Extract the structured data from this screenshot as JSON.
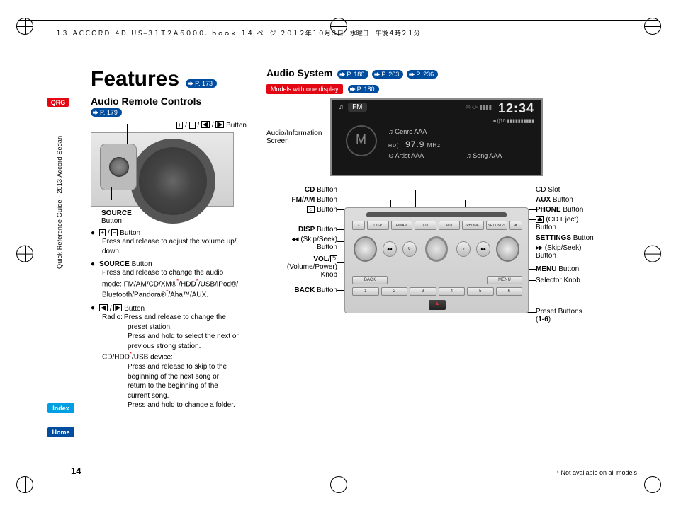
{
  "header": "１３ ＡＣＣＯＲＤ ４Ｄ ＵＳ−３１Ｔ２Ａ６０００．ｂｏｏｋ  １４ ページ  ２０１２年１０月３日　水曜日　午後４時２１分",
  "side_guide": "Quick Reference Guide - 2013 Accord Sedan",
  "tabs": {
    "qrg": "QRG",
    "index": "Index",
    "home": "Home"
  },
  "page_number": "14",
  "footnote_prefix": "*",
  "footnote": " Not available on all models",
  "features": {
    "title": "Features",
    "page_ref": "P. 173",
    "audio_remote_heading": "Audio Remote Controls",
    "audio_remote_ref": "P. 179",
    "steering_fig_caption_top": " /  /  /  Button",
    "source_label1": "SOURCE",
    "source_label2": "Button",
    "bullets": {
      "b1_line1": "Press and release to adjust the volume up/",
      "b1_line2": "down.",
      "b2_label": "SOURCE",
      "b2_suffix": " Button",
      "b2_line1": "Press and release to change the audio",
      "b2_line2": "mode: FM/AM/CD/XM®",
      "b2_line2b": "/HDD",
      "b2_line2c": "/USB/iPod®/",
      "b2_line3": "Bluetooth/Pandora®",
      "b2_line3b": "/Aha™/AUX.",
      "b3_suffix": " Button",
      "b3_radio_label": "Radio:",
      "b3_r_line1": "Press and release to change the",
      "b3_r_line2": "preset station.",
      "b3_r_line3": "Press and hold to select the next or",
      "b3_r_line4": "previous strong station.",
      "b3_cd_label1": "CD/HDD",
      "b3_cd_label2": "/USB device:",
      "b3_c_line1": "Press and release to skip to the",
      "b3_c_line2": "beginning of the next song or",
      "b3_c_line3": "return to the beginning of the",
      "b3_c_line4": "current song.",
      "b3_c_line5": "Press and hold to change a folder."
    }
  },
  "audio_system": {
    "title": "Audio System",
    "refs": [
      "P. 180",
      "P. 203",
      "P. 236"
    ],
    "model_tag": "Models with one display",
    "model_ref": "P. 180",
    "screen_label1": "Audio/Information",
    "screen_label2": "Screen",
    "screen": {
      "band": "FM",
      "bt": "❊ ⧂ ▮▮▮▮",
      "clock": "12:34",
      "vol": "◄))10 ▮▮▮▮▮▮▮▮▮▮",
      "genre_prefix": "♫ Genre ",
      "freq": "97.9",
      "freq_unit": " MHz",
      "artist_prefix": "⊙ Artist ",
      "song_prefix": "♫ Song ",
      "aaa": "AAA"
    },
    "left_labels": {
      "cd": "CD",
      "cd_suf": " Button",
      "fmam": "FM/AM",
      "fmam_suf": " Button",
      "bright": "Button",
      "disp": "DISP",
      "disp_suf": " Button",
      "skip_prev1": "(Skip/Seek)",
      "skip_prev2": "Button",
      "vol": "VOL/",
      "vol_sub1": "(Volume/Power)",
      "vol_sub2": "Knob",
      "back": "BACK",
      "back_suf": " Button"
    },
    "right_labels": {
      "slot": "CD Slot",
      "aux": "AUX",
      "aux_suf": " Button",
      "phone": "PHONE",
      "phone_suf": " Button",
      "eject_suf": " (CD Eject)",
      "eject_suf2": "Button",
      "settings": "SETTINGS",
      "settings_suf": " Button",
      "skip_next1": "(Skip/Seek)",
      "skip_next2": "Button",
      "menu": "MENU",
      "menu_suf": " Button",
      "selector": "Selector Knob",
      "preset1": "Preset Buttons",
      "preset2": "(",
      "preset3": "1-6",
      "preset4": ")"
    },
    "unit_btns": {
      "disp": "DISP",
      "fmam": "FM/AM",
      "cd": "CD",
      "aux": "AUX",
      "phone": "PHONE",
      "settings": "SETTINGS",
      "back": "BACK",
      "menu": "MENU",
      "p1": "1",
      "p2": "2",
      "p3": "3",
      "p4": "4",
      "p5": "5",
      "p6": "6"
    }
  }
}
